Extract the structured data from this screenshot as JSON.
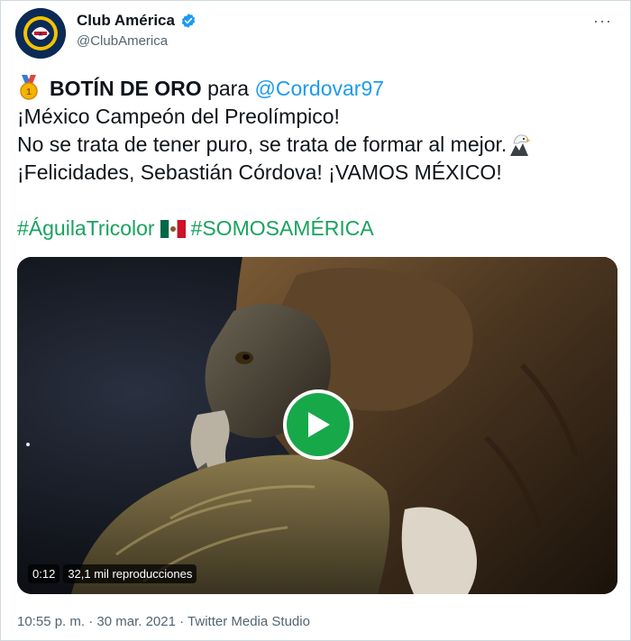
{
  "header": {
    "name": "Club América",
    "handle": "@ClubAmerica",
    "verified_color": "#1d9bf0",
    "more_label": "···"
  },
  "tweet": {
    "line1_bold": "BOTÍN DE ORO",
    "line1_mid": "para",
    "line1_mention": "@Cordovar97",
    "line2": "¡México Campeón del Preolímpico!",
    "line3": "No se trata de tener puro, se trata de formar al mejor.",
    "line4": "¡Felicidades, Sebastián Córdova! ¡VAMOS MÉXICO!",
    "hashtag1": "#ÁguilaTricolor",
    "hashtag2": "#SOMOSAMÉRICA",
    "icons": [
      "medal-icon",
      "eagle-emoji-icon",
      "mexico-flag-icon"
    ]
  },
  "video": {
    "duration": "0:12",
    "views": "32,1 mil reproducciones",
    "play_color": "#17a84a"
  },
  "footer": {
    "time": "10:55 p. m.",
    "sep": "·",
    "date": "30 mar. 2021",
    "source": "Twitter Media Studio"
  }
}
